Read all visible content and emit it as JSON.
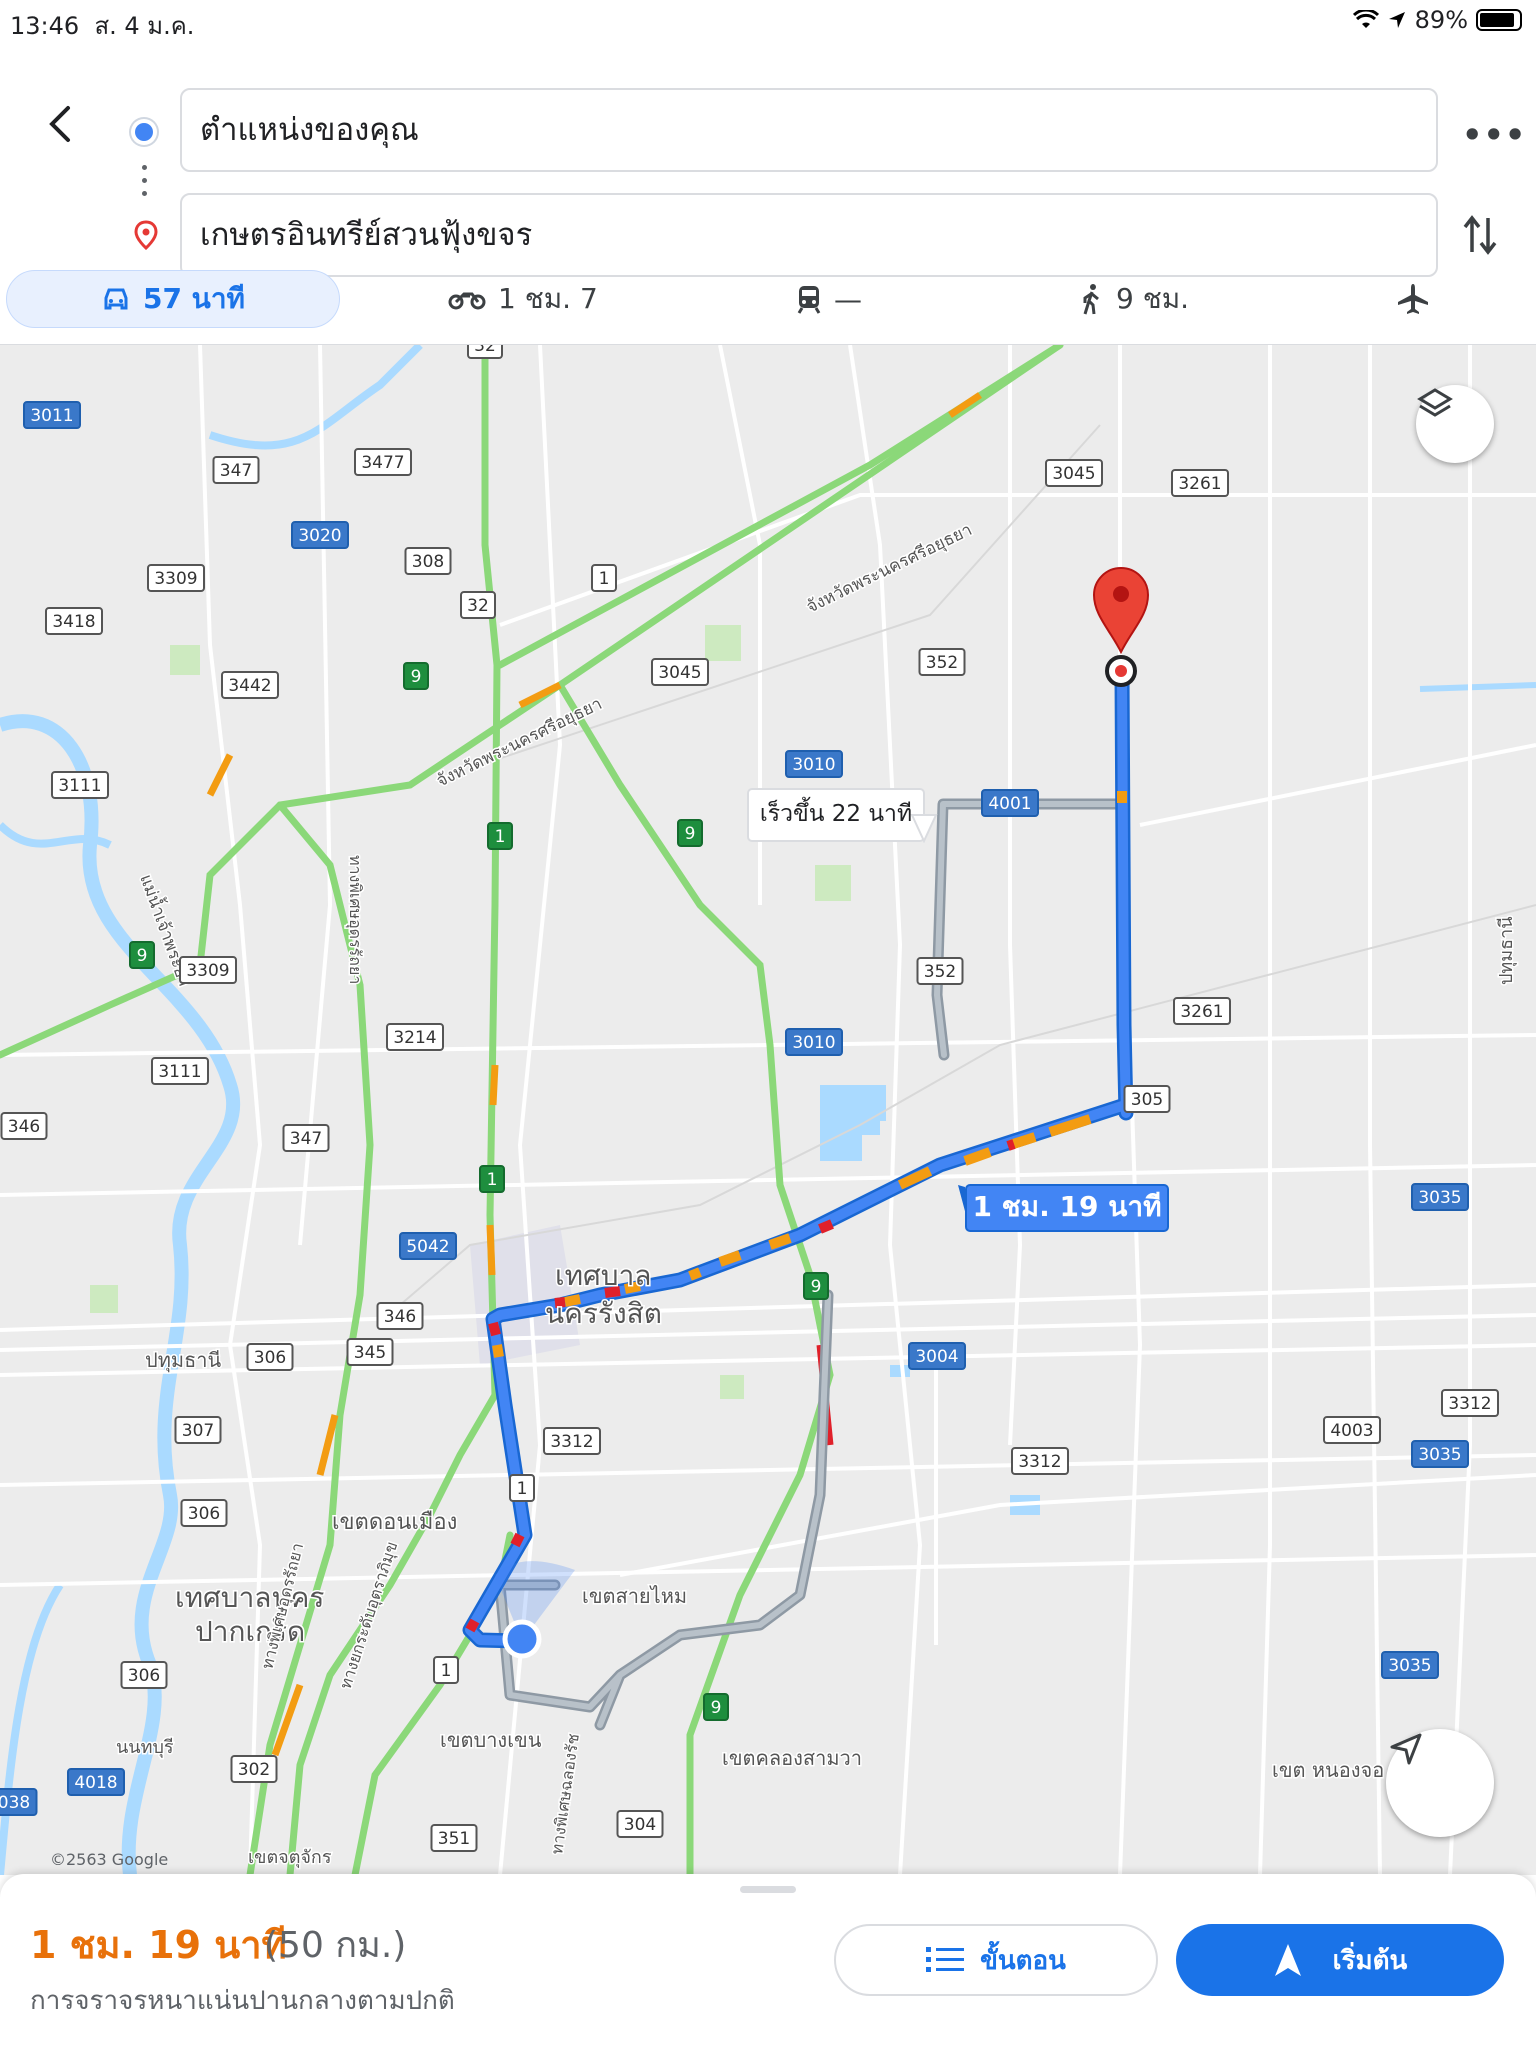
{
  "status_bar": {
    "time": "13:46",
    "date": "ส. 4 ม.ค.",
    "battery": "89%",
    "battery_level": 0.89
  },
  "directions": {
    "origin": "ตำแหน่งของคุณ",
    "destination": "เกษตรอินทรีย์สวนฟุ้งขจร"
  },
  "modes": {
    "drive": {
      "icon": "car-icon",
      "label": "57 นาที",
      "selected": true
    },
    "motorbike": {
      "icon": "motorbike-icon",
      "label": "1 ชม. 7"
    },
    "transit": {
      "icon": "train-icon",
      "label": "—"
    },
    "walk": {
      "icon": "walk-icon",
      "label": "9 ชม."
    },
    "flight": {
      "icon": "airplane-icon"
    }
  },
  "map": {
    "route_label": "1 ชม. 19 นาที",
    "alt_route_label": "เร็วขึ้น 22 นาที",
    "copyright": "©2563 Google",
    "place_labels": [
      {
        "text": "เทศบาล",
        "key": "rangsit1"
      },
      {
        "text": "นครรังสิต",
        "key": "rangsit2"
      },
      {
        "text": "เขตดอนเมือง",
        "key": "donmueang"
      },
      {
        "text": "เทศบาลนคร",
        "key": "pakkret1"
      },
      {
        "text": "ปากเกร็ด",
        "key": "pakkret2"
      },
      {
        "text": "เขตสายไหม",
        "key": "saimai"
      },
      {
        "text": "เขตบางเขน",
        "key": "bangkhen"
      },
      {
        "text": "เขตคลองสามวา",
        "key": "khlongsamwa"
      },
      {
        "text": "เขต หนองจอ",
        "key": "nongchok"
      },
      {
        "text": "เขตจตุจักร",
        "key": "chatuchak"
      },
      {
        "text": "นนทบุรี",
        "key": "nonthaburi"
      },
      {
        "text": "ปทุมธานี",
        "key": "pathumthani1"
      },
      {
        "text": "ปทุมธานี",
        "key": "pathumthani2"
      },
      {
        "text": "จังหวัดพระนครศรีอยุธยา",
        "key": "ayutthaya1"
      },
      {
        "text": "จังหวัดพระนครศรีอยุธยา",
        "key": "ayutthaya2"
      },
      {
        "text": "แม่น้ำเจ้าพระยา",
        "key": "river"
      },
      {
        "text": "ทางพิเศษอุดรรัถยา",
        "key": "udonratthaya"
      },
      {
        "text": "ทางยกระดับอุตราภิมุข",
        "key": "uttaraphimuk"
      },
      {
        "text": "ทางพิเศษฉลองรัช",
        "key": "chalongrat"
      },
      {
        "text": "ทางพิเศษอุดรรัถยา",
        "key": "udonratthaya2"
      }
    ],
    "route_shields": [
      {
        "text": "32",
        "style": "white"
      },
      {
        "text": "3011",
        "style": "blue"
      },
      {
        "text": "347",
        "style": "white"
      },
      {
        "text": "3477",
        "style": "white"
      },
      {
        "text": "3020",
        "style": "blue"
      },
      {
        "text": "3309",
        "style": "white"
      },
      {
        "text": "308",
        "style": "white"
      },
      {
        "text": "1",
        "style": "white"
      },
      {
        "text": "3045",
        "style": "white"
      },
      {
        "text": "3261",
        "style": "white"
      },
      {
        "text": "3418",
        "style": "white"
      },
      {
        "text": "32",
        "style": "white"
      },
      {
        "text": "9",
        "style": "green"
      },
      {
        "text": "3045",
        "style": "white"
      },
      {
        "text": "352",
        "style": "white"
      },
      {
        "text": "3442",
        "style": "white"
      },
      {
        "text": "3111",
        "style": "white"
      },
      {
        "text": "3010",
        "style": "blue"
      },
      {
        "text": "4001",
        "style": "blue"
      },
      {
        "text": "1",
        "style": "green"
      },
      {
        "text": "9",
        "style": "green"
      },
      {
        "text": "9",
        "style": "green"
      },
      {
        "text": "3309",
        "style": "white"
      },
      {
        "text": "352",
        "style": "white"
      },
      {
        "text": "3261",
        "style": "white"
      },
      {
        "text": "3214",
        "style": "white"
      },
      {
        "text": "3010",
        "style": "blue"
      },
      {
        "text": "3111",
        "style": "white"
      },
      {
        "text": "305",
        "style": "white"
      },
      {
        "text": "346",
        "style": "white"
      },
      {
        "text": "347",
        "style": "white"
      },
      {
        "text": "1",
        "style": "green"
      },
      {
        "text": "3035",
        "style": "blue"
      },
      {
        "text": "5042",
        "style": "blue"
      },
      {
        "text": "9",
        "style": "green"
      },
      {
        "text": "346",
        "style": "white"
      },
      {
        "text": "306",
        "style": "white"
      },
      {
        "text": "345",
        "style": "white"
      },
      {
        "text": "3004",
        "style": "blue"
      },
      {
        "text": "307",
        "style": "white"
      },
      {
        "text": "3312",
        "style": "white"
      },
      {
        "text": "4003",
        "style": "white"
      },
      {
        "text": "3312",
        "style": "white"
      },
      {
        "text": "3035",
        "style": "blue"
      },
      {
        "text": "1",
        "style": "white"
      },
      {
        "text": "3312",
        "style": "white"
      },
      {
        "text": "306",
        "style": "white"
      },
      {
        "text": "306",
        "style": "white"
      },
      {
        "text": "1",
        "style": "white"
      },
      {
        "text": "3035",
        "style": "blue"
      },
      {
        "text": "9",
        "style": "green"
      },
      {
        "text": "302",
        "style": "white"
      },
      {
        "text": "4018",
        "style": "blue"
      },
      {
        "text": "038",
        "style": "blue"
      },
      {
        "text": "304",
        "style": "white"
      },
      {
        "text": "351",
        "style": "white"
      }
    ]
  },
  "summary": {
    "duration": "1 ชม. 19 นาที",
    "distance": "(50 กม.)",
    "traffic": "การจราจรหนาแน่นปานกลางตามปกติ",
    "steps_label": "ขั้นตอน",
    "start_label": "เริ่มต้น"
  },
  "colors": {
    "route_blue": "#4285f4",
    "traffic_orange": "#f39c12",
    "traffic_red": "#e0202a",
    "alt_route": "#a9b2bb",
    "road_green": "#8bd879",
    "accent": "#1a73e8",
    "duration_orange": "#e8710a"
  }
}
